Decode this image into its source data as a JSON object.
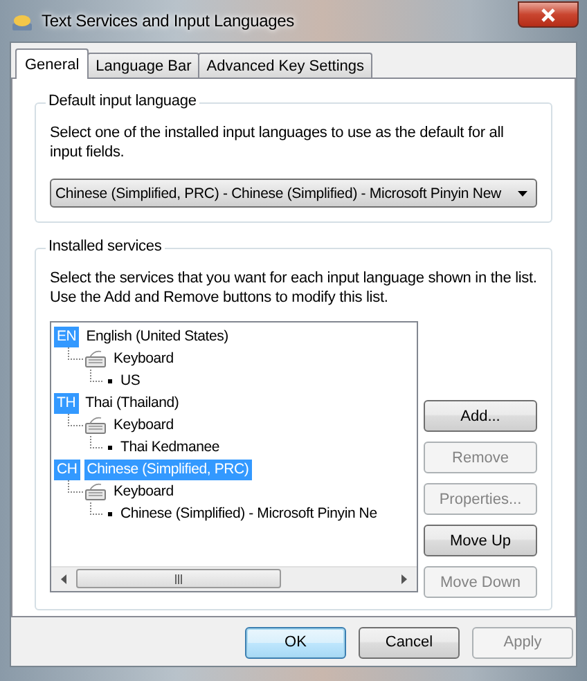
{
  "window": {
    "title": "Text Services and Input Languages"
  },
  "tabs": [
    {
      "label": "General",
      "selected": true
    },
    {
      "label": "Language Bar",
      "selected": false
    },
    {
      "label": "Advanced Key Settings",
      "selected": false
    }
  ],
  "default_input_language": {
    "label": "Default input language",
    "description": "Select one of the installed input languages to use as the default for all input fields.",
    "dropdown": {
      "value": "Chinese (Simplified, PRC) - Chinese (Simplified) - Microsoft Pinyin New"
    }
  },
  "installed_services": {
    "label": "Installed services",
    "description": "Select the services that you want for each input language shown in the list. Use the Add and Remove buttons to modify this list.",
    "tree": [
      {
        "badge": "EN",
        "label": "English (United States)",
        "selected": false,
        "children": [
          {
            "label": "Keyboard",
            "children": [
              {
                "label": "US"
              }
            ]
          }
        ]
      },
      {
        "badge": "TH",
        "label": "Thai (Thailand)",
        "selected": false,
        "children": [
          {
            "label": "Keyboard",
            "children": [
              {
                "label": "Thai Kedmanee"
              }
            ]
          }
        ]
      },
      {
        "badge": "CH",
        "label": "Chinese (Simplified, PRC)",
        "selected": true,
        "children": [
          {
            "label": "Keyboard",
            "children": [
              {
                "label": "Chinese (Simplified) - Microsoft Pinyin Ne"
              }
            ]
          }
        ]
      }
    ],
    "buttons": [
      {
        "label": "Add...",
        "disabled": false
      },
      {
        "label": "Remove",
        "disabled": true
      },
      {
        "label": "Properties...",
        "disabled": true
      },
      {
        "label": "Move Up",
        "disabled": false
      },
      {
        "label": "Move Down",
        "disabled": true
      }
    ]
  },
  "buttons": [
    {
      "label": "OK",
      "disabled": false,
      "default": true
    },
    {
      "label": "Cancel",
      "disabled": false,
      "default": false
    },
    {
      "label": "Apply",
      "disabled": true,
      "default": false
    }
  ]
}
